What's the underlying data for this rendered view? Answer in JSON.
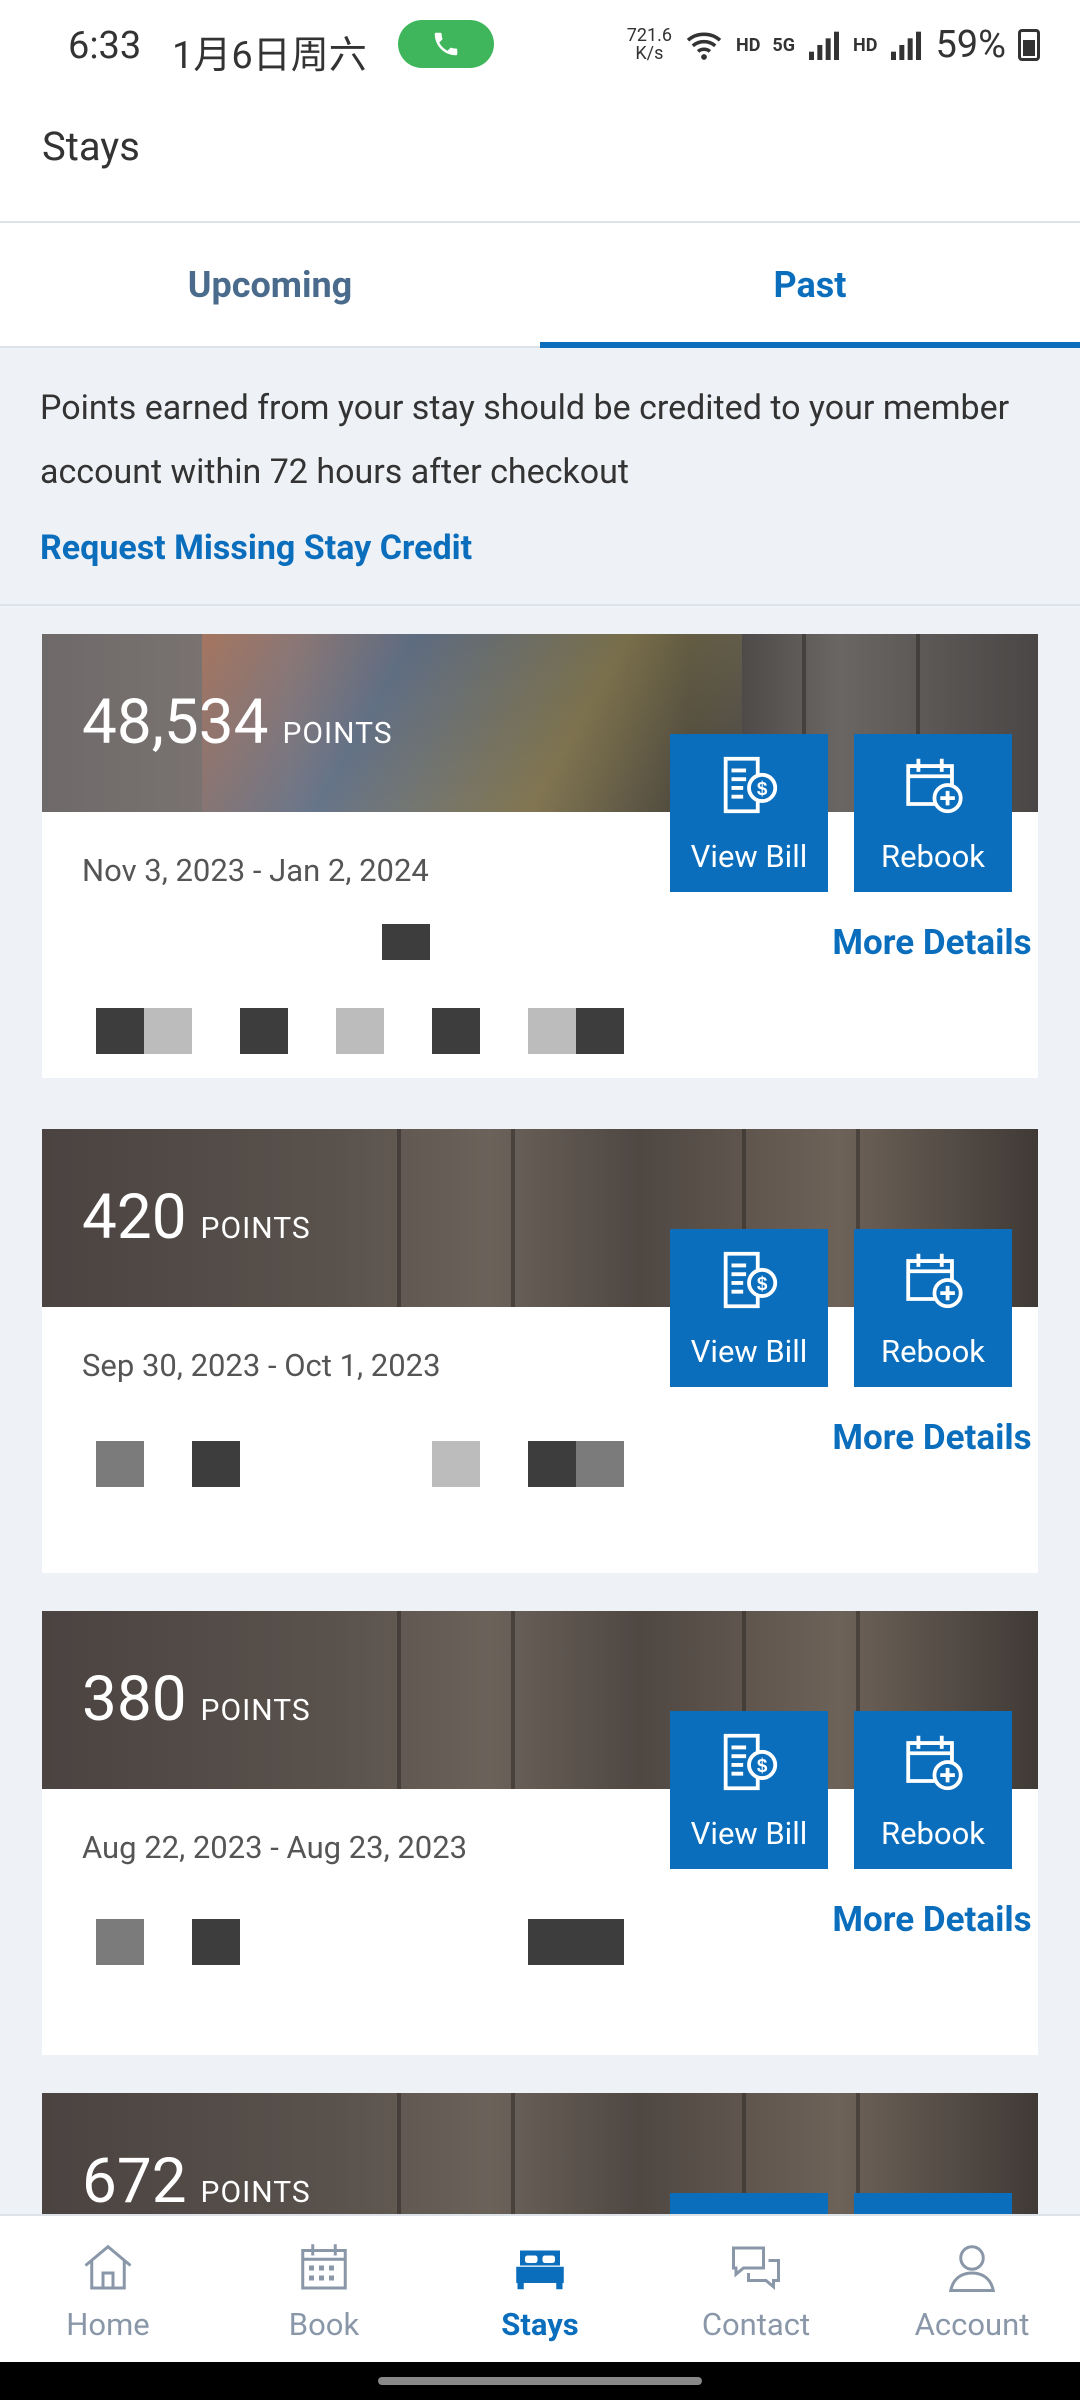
{
  "status": {
    "time": "6:33",
    "date": "1月6日周六",
    "speed_value": "721.6",
    "speed_unit": "K/s",
    "net1": "HD",
    "net2": "5G",
    "net3": "HD",
    "battery": "59%"
  },
  "header": {
    "title": "Stays"
  },
  "tabs": [
    {
      "label": "Upcoming",
      "selected": false
    },
    {
      "label": "Past",
      "selected": true
    }
  ],
  "notice": {
    "text": "Points earned from your stay should be credited to your member account within 72 hours after checkout",
    "link": "Request Missing Stay Credit"
  },
  "stays": [
    {
      "points": "48,534",
      "points_label": "POINTS",
      "dates": "Nov 3, 2023 - Jan 2, 2024",
      "view_bill": "View Bill",
      "rebook": "Rebook",
      "more": "More Details"
    },
    {
      "points": "420",
      "points_label": "POINTS",
      "dates": "Sep 30, 2023 - Oct 1, 2023",
      "view_bill": "View Bill",
      "rebook": "Rebook",
      "more": "More Details"
    },
    {
      "points": "380",
      "points_label": "POINTS",
      "dates": "Aug 22, 2023 - Aug 23, 2023",
      "view_bill": "View Bill",
      "rebook": "Rebook",
      "more": "More Details"
    },
    {
      "points": "672",
      "points_label": "POINTS"
    }
  ],
  "nav": [
    {
      "label": "Home",
      "icon": "home-icon",
      "active": false
    },
    {
      "label": "Book",
      "icon": "calendar-icon",
      "active": false
    },
    {
      "label": "Stays",
      "icon": "bed-icon",
      "active": true
    },
    {
      "label": "Contact",
      "icon": "chat-icon",
      "active": false
    },
    {
      "label": "Account",
      "icon": "user-icon",
      "active": false
    }
  ],
  "colors": {
    "accent": "#0a6ebd",
    "tab_inactive": "#4a6b8c",
    "nav_inactive": "#8a97a8",
    "background": "#eef1f5"
  }
}
